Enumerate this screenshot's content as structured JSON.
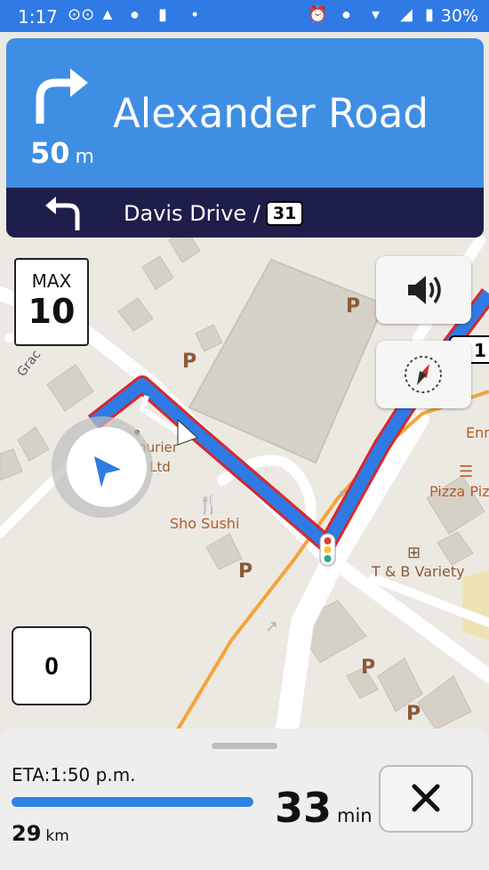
{
  "status_bar": {
    "time": "1:17",
    "battery": "30%",
    "icons": [
      "voicemail-icon",
      "navigation-icon",
      "location-icon",
      "sd-card-icon",
      "dot-icon",
      "alarm-icon",
      "location-icon",
      "wifi-icon",
      "signal-icon",
      "battery-icon"
    ]
  },
  "instruction": {
    "street": "Alexander Road",
    "distance": "50",
    "distance_unit": "m",
    "maneuver_icon": "turn-right-icon",
    "color": "#3e8ee4"
  },
  "next_instruction": {
    "street": "Davis Drive /",
    "route_number": "31",
    "maneuver_icon": "turn-left-icon",
    "color": "#1d1e4a"
  },
  "speed_limit": {
    "label": "MAX",
    "value": "10"
  },
  "current_speed": "0",
  "map_labels": {
    "grace": "Grac",
    "courier_1": "Courier",
    "courier_2": "e Ltd",
    "sho_sushi": "Sho Sushi",
    "pizza": "Pizza Pizz",
    "enn": "Enn",
    "tb_variety": "T & B Variety",
    "parking": "P",
    "route_shield_edge": "1"
  },
  "buttons": {
    "sound": "sound-icon",
    "compass": "compass-icon",
    "close": "close-icon"
  },
  "trip": {
    "eta": "ETA:1:50 p.m.",
    "progress": 1.0,
    "remaining_distance": "29",
    "remaining_distance_unit": "km",
    "remaining_time": "33",
    "remaining_time_unit": "min"
  },
  "colors": {
    "route": "#2f7ae5",
    "route_outline": "#d9262c",
    "status_bar": "#2f7ae5",
    "road_orange": "#f4a43a"
  }
}
